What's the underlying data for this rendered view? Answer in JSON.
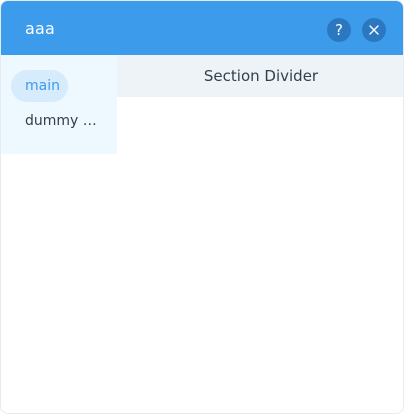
{
  "window": {
    "title": "aaa",
    "help_glyph": "?",
    "help_icon": "question-mark",
    "close_icon": "x-mark",
    "accent_color": "#3d9bec"
  },
  "sidebar": {
    "items": [
      {
        "label": "main",
        "active": true
      },
      {
        "label": "dummy t..."
      }
    ]
  },
  "main": {
    "section_title": "Section Divider"
  }
}
